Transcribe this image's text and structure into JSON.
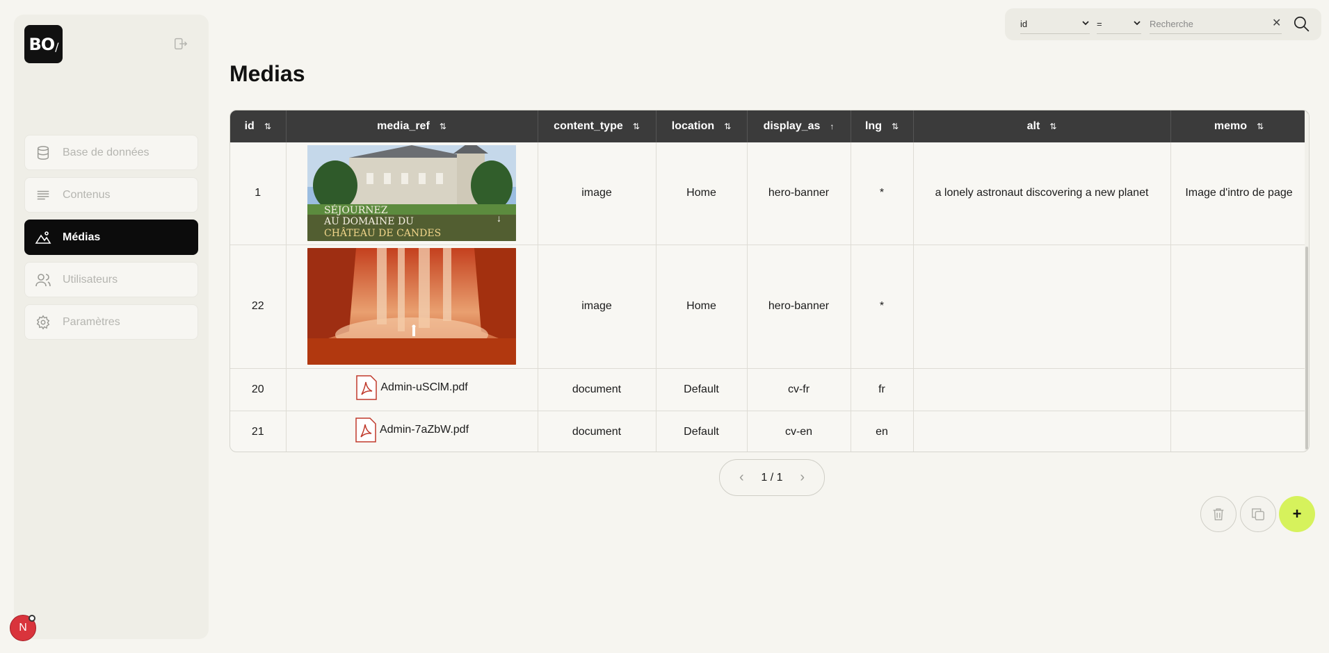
{
  "brand": {
    "logo_text": "BO",
    "logo_slash": "/"
  },
  "sidebar": {
    "items": [
      {
        "label": "Base de données",
        "icon": "database-icon",
        "active": false
      },
      {
        "label": "Contenus",
        "icon": "text-lines-icon",
        "active": false
      },
      {
        "label": "Médias",
        "icon": "image-mountain-icon",
        "active": true
      },
      {
        "label": "Utilisateurs",
        "icon": "users-icon",
        "active": false
      },
      {
        "label": "Paramètres",
        "icon": "gear-icon",
        "active": false
      }
    ]
  },
  "user": {
    "avatar_initial": "N"
  },
  "search": {
    "field": "id",
    "operator": "=",
    "placeholder": "Recherche",
    "value": ""
  },
  "page": {
    "title": "Medias"
  },
  "table": {
    "columns": [
      "id",
      "media_ref",
      "content_type",
      "location",
      "display_as",
      "lng",
      "alt",
      "memo"
    ],
    "sort_icons": [
      "⇅",
      "⇅",
      "⇅",
      "⇅",
      "↑",
      "⇅",
      "⇅",
      "⇅"
    ],
    "rows": [
      {
        "id": "1",
        "media_ref": "",
        "content_type": "image",
        "location": "Home",
        "display_as": "hero-banner",
        "lng": "*",
        "alt": "a lonely astronaut discovering a new planet",
        "memo": "Image d'intro de page",
        "banner_text": [
          "SÉJOURNEZ",
          "AU DOMAINE DU",
          "CHÂTEAU DE CANDES"
        ]
      },
      {
        "id": "22",
        "media_ref": "",
        "content_type": "image",
        "location": "Home",
        "display_as": "hero-banner",
        "lng": "*",
        "alt": "",
        "memo": ""
      },
      {
        "id": "20",
        "media_ref": "Admin-uSClM.pdf",
        "content_type": "document",
        "location": "Default",
        "display_as": "cv-fr",
        "lng": "fr",
        "alt": "",
        "memo": ""
      },
      {
        "id": "21",
        "media_ref": "Admin-7aZbW.pdf",
        "content_type": "document",
        "location": "Default",
        "display_as": "cv-en",
        "lng": "en",
        "alt": "",
        "memo": ""
      }
    ]
  },
  "pagination": {
    "label": "1 / 1"
  },
  "actions": {
    "add_label": "+"
  },
  "colors": {
    "accent": "#d6f25c",
    "active_nav": "#0c0c0c",
    "header": "#3b3b3b",
    "avatar": "#d9343c"
  }
}
